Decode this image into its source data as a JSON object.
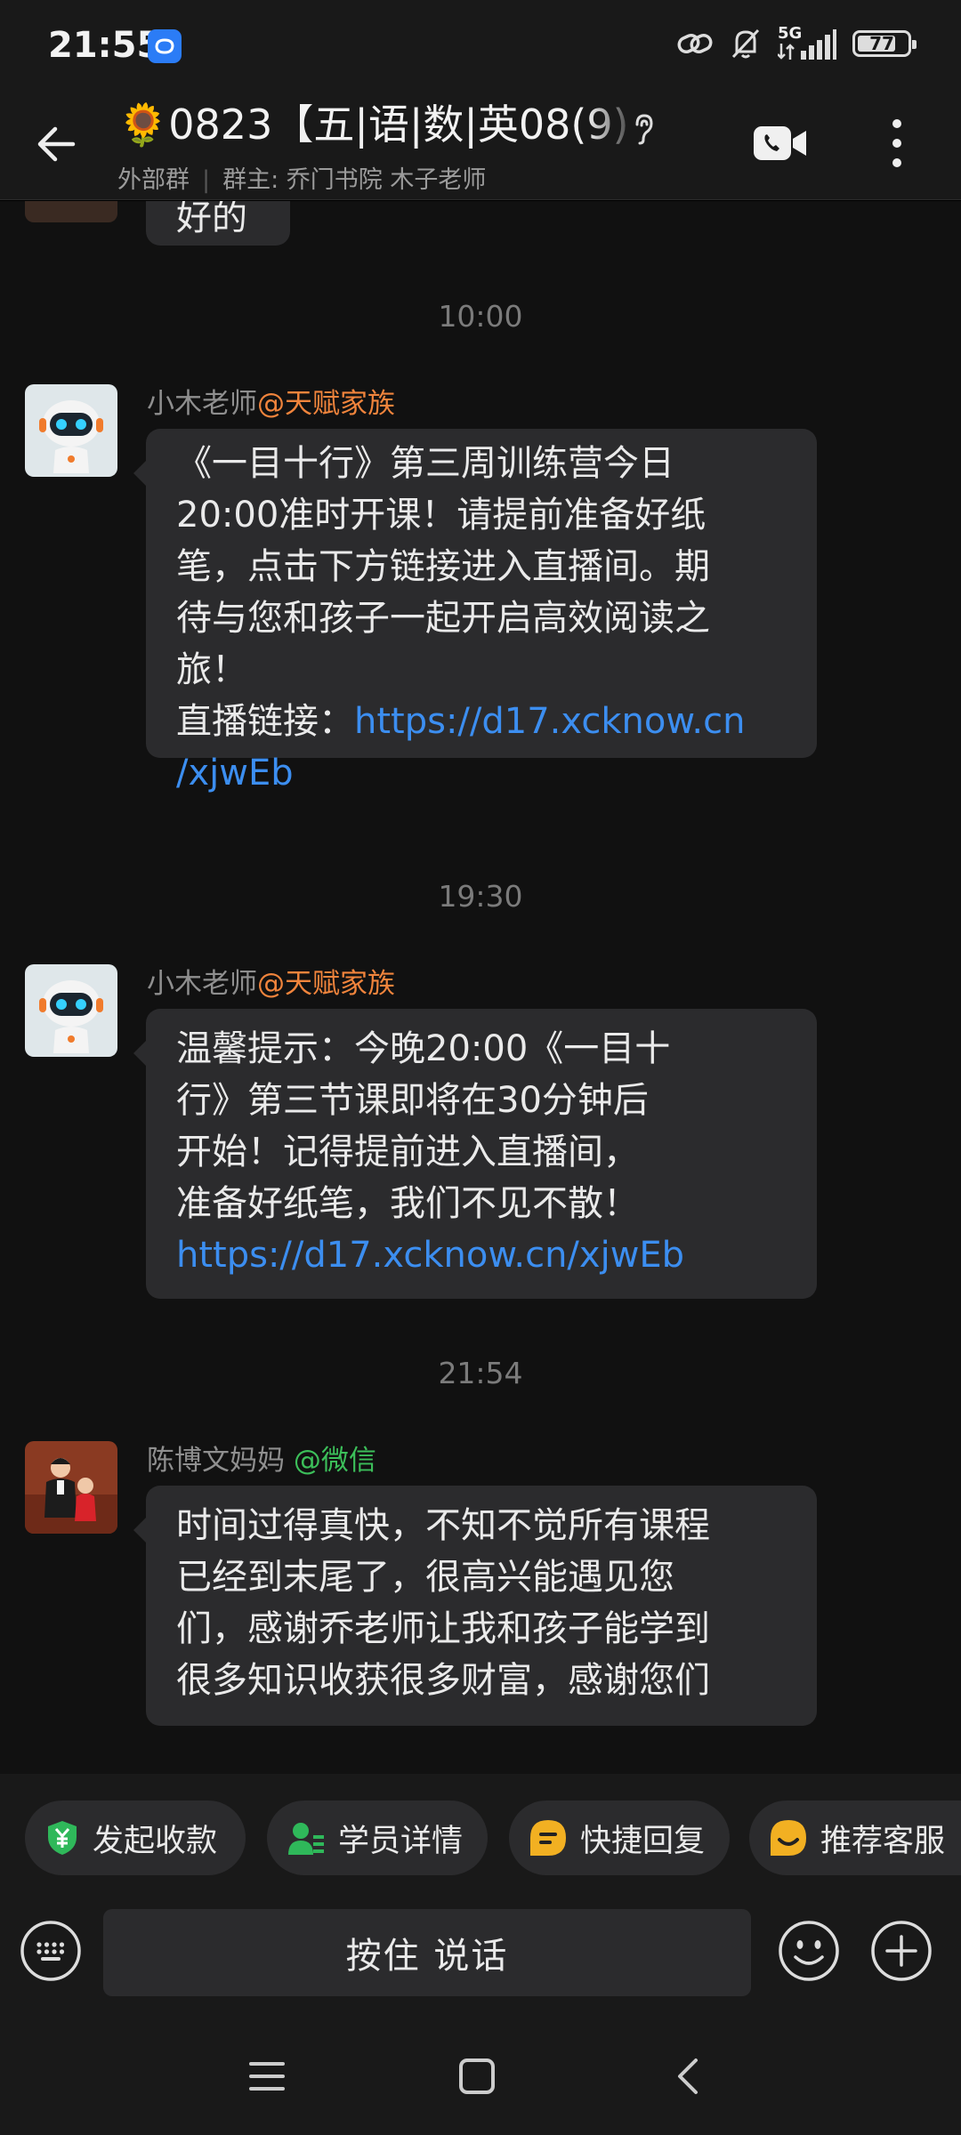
{
  "status_bar": {
    "time": "21:55",
    "network": "5G",
    "battery": 77,
    "battery_label": "77"
  },
  "header": {
    "title": "🌻0823【五|语|数|英08(9)",
    "group_type": "外部群",
    "owner": "群主: 乔门书院 木子老师"
  },
  "chat": {
    "partial_message": "好的",
    "messages": [
      {
        "time": "10:00",
        "sender": "小木老师",
        "tag": "@天赋家族",
        "lines": [
          "《一目十行》第三周训练营今日",
          "20:00准时开课！请提前准备好纸",
          "笔，点击下方链接进入直播间。期",
          "待与您和孩子一起开启高效阅读之",
          "旅！"
        ],
        "link_prefix": "直播链接：",
        "link_line1": "https://d17.xcknow.cn",
        "link_line2": "/xjwEb"
      },
      {
        "time": "19:30",
        "sender": "小木老师",
        "tag": "@天赋家族",
        "lines": [
          "温馨提示：今晚20:00《一目十",
          "行》第三节课即将在30分钟后",
          "开始！记得提前进入直播间，",
          "准备好纸笔，我们不见不散！"
        ],
        "link": "https://d17.xcknow.cn/xjwEb"
      },
      {
        "time": "21:54",
        "sender": "陈博文妈妈",
        "tag": "@微信",
        "lines": [
          "时间过得真快，不知不觉所有课程",
          "已经到末尾了，很高兴能遇见您",
          "们，感谢乔老师让我和孩子能学到",
          "很多知识收获很多财富，感谢您们"
        ]
      }
    ]
  },
  "quick_actions": [
    {
      "label": "发起收款",
      "icon": "yen-shield-icon",
      "color": "#2fb85a"
    },
    {
      "label": "学员详情",
      "icon": "user-card-icon",
      "color": "#2fb85a"
    },
    {
      "label": "快捷回复",
      "icon": "quick-reply-icon",
      "color": "#f2b022"
    },
    {
      "label": "推荐客服",
      "icon": "service-icon",
      "color": "#f2b022"
    }
  ],
  "input": {
    "voice_label": "按住 说话"
  }
}
